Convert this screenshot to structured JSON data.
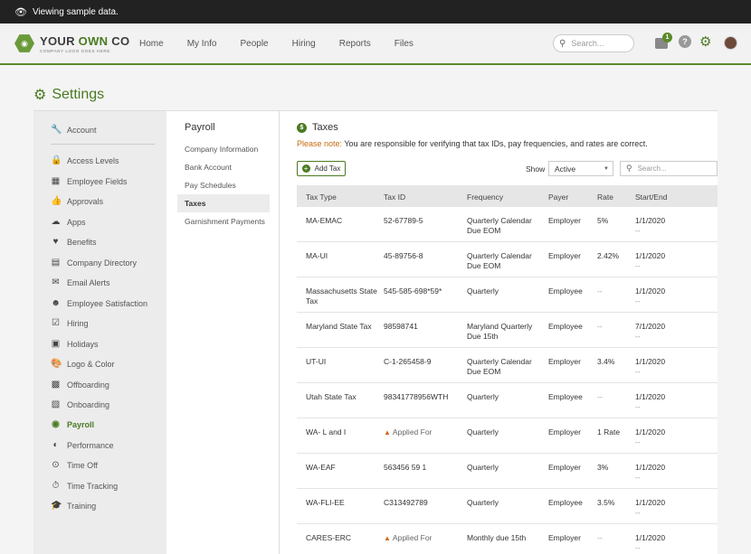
{
  "banner": {
    "text": "Viewing sample data."
  },
  "header": {
    "logo_main_a": "YOUR ",
    "logo_main_b": "OWN",
    "logo_main_c": " CO",
    "logo_sub": "COMPANY LOGO GOES HERE",
    "nav": [
      "Home",
      "My Info",
      "People",
      "Hiring",
      "Reports",
      "Files"
    ],
    "search_placeholder": "Search...",
    "inbox_count": "1",
    "help": "?"
  },
  "page": {
    "title": "Settings"
  },
  "sidebar": {
    "top": {
      "label": "Account",
      "icon": "wrench-icon"
    },
    "items": [
      {
        "label": "Access Levels",
        "icon": "lock-icon"
      },
      {
        "label": "Employee Fields",
        "icon": "id-card-icon"
      },
      {
        "label": "Approvals",
        "icon": "thumbs-up-icon"
      },
      {
        "label": "Apps",
        "icon": "cloud-icon"
      },
      {
        "label": "Benefits",
        "icon": "heart-icon"
      },
      {
        "label": "Company Directory",
        "icon": "address-book-icon"
      },
      {
        "label": "Email Alerts",
        "icon": "envelope-icon"
      },
      {
        "label": "Employee Satisfaction",
        "icon": "smile-icon"
      },
      {
        "label": "Hiring",
        "icon": "clipboard-icon"
      },
      {
        "label": "Holidays",
        "icon": "calendar-icon"
      },
      {
        "label": "Logo & Color",
        "icon": "palette-icon"
      },
      {
        "label": "Offboarding",
        "icon": "box-icon"
      },
      {
        "label": "Onboarding",
        "icon": "id-badge-icon"
      },
      {
        "label": "Payroll",
        "icon": "dollar-icon"
      },
      {
        "label": "Performance",
        "icon": "gauge-icon"
      },
      {
        "label": "Time Off",
        "icon": "bicycle-icon"
      },
      {
        "label": "Time Tracking",
        "icon": "stopwatch-icon"
      },
      {
        "label": "Training",
        "icon": "graduation-cap-icon"
      }
    ],
    "active": "Payroll"
  },
  "subnav": {
    "title": "Payroll",
    "items": [
      "Company Information",
      "Bank Account",
      "Pay Schedules",
      "Taxes",
      "Garnishment Payments"
    ],
    "active": "Taxes"
  },
  "content": {
    "title": "Taxes",
    "note_label": "Please note:",
    "note_text": " You are responsible for verifying that tax IDs, pay frequencies, and rates are correct.",
    "add_button": "Add Tax",
    "show_label": "Show",
    "show_value": "Active",
    "search_placeholder": "Search...",
    "columns": [
      "Tax Type",
      "Tax ID",
      "Frequency",
      "Payer",
      "Rate",
      "Start/End"
    ],
    "rows": [
      {
        "type": "MA-EMAC",
        "id": "52-67789-5",
        "freq": "Quarterly Calendar Due EOM",
        "payer": "Employer",
        "rate": "5%",
        "start": "1/1/2020",
        "end": "--"
      },
      {
        "type": "MA-UI",
        "id": "45-89756-8",
        "freq": "Quarterly Calendar Due EOM",
        "payer": "Employer",
        "rate": "2.42%",
        "start": "1/1/2020",
        "end": "--"
      },
      {
        "type": "Massachusetts State Tax",
        "id": "545-585-698*59*",
        "freq": "Quarterly",
        "payer": "Employee",
        "rate": "--",
        "start": "1/1/2020",
        "end": "--"
      },
      {
        "type": "Maryland State Tax",
        "id": "98598741",
        "freq": "Maryland Quarterly Due 15th",
        "payer": "Employee",
        "rate": "--",
        "start": "7/1/2020",
        "end": "--"
      },
      {
        "type": "UT-UI",
        "id": "C-1-265458-9",
        "freq": "Quarterly Calendar Due EOM",
        "payer": "Employer",
        "rate": "3.4%",
        "start": "1/1/2020",
        "end": "--"
      },
      {
        "type": "Utah State Tax",
        "id": "98341778956WTH",
        "freq": "Quarterly",
        "payer": "Employee",
        "rate": "--",
        "start": "1/1/2020",
        "end": "--"
      },
      {
        "type": "WA- L and I",
        "id": "Applied For",
        "applied": true,
        "freq": "Quarterly",
        "payer": "Employer",
        "rate": "1 Rate",
        "start": "1/1/2020",
        "end": "--"
      },
      {
        "type": "WA-EAF",
        "id": "563456 59 1",
        "freq": "Quarterly",
        "payer": "Employer",
        "rate": "3%",
        "start": "1/1/2020",
        "end": "--"
      },
      {
        "type": "WA-FLI-EE",
        "id": "C313492789",
        "freq": "Quarterly",
        "payer": "Employee",
        "rate": "3.5%",
        "start": "1/1/2020",
        "end": "--"
      },
      {
        "type": "CARES-ERC",
        "id": "Applied For",
        "applied": true,
        "freq": "Monthly due 15th",
        "payer": "Employer",
        "rate": "--",
        "start": "1/1/2020",
        "end": "--"
      }
    ]
  },
  "colors": {
    "brand_green": "#4a7a22",
    "note_orange": "#c86a10",
    "warning": "#d2691e"
  }
}
